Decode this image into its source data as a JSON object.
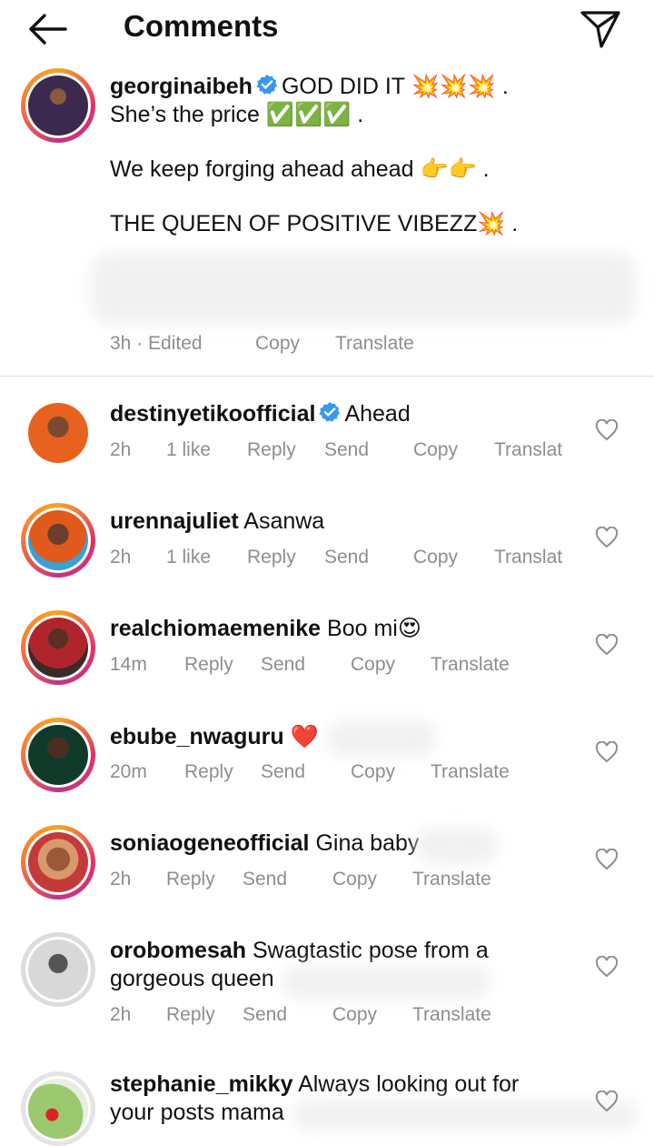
{
  "header": {
    "title": "Comments"
  },
  "caption": {
    "username": "georginaibeh",
    "line1": "GOD DID IT 💥💥💥 .",
    "line2": "She’s the price ✅✅✅ .",
    "line3": "We keep forging ahead ahead 👉👉 .",
    "line4": "THE QUEEN OF POSITIVE VIBEZZ💥 .",
    "time": "3h · Edited",
    "copy": "Copy",
    "translate": "Translate"
  },
  "comments": [
    {
      "username": "destinyetikoofficial",
      "text": "Ahead",
      "time": "2h",
      "likes": "1 like",
      "reply": "Reply",
      "send": "Send",
      "copy": "Copy",
      "translate": "Translat"
    },
    {
      "username": "urennajuliet",
      "text": "Asanwa",
      "time": "2h",
      "likes": "1 like",
      "reply": "Reply",
      "send": "Send",
      "copy": "Copy",
      "translate": "Translat"
    },
    {
      "username": "realchiomaemenike",
      "text": "Boo mi😍",
      "time": "14m",
      "reply": "Reply",
      "send": "Send",
      "copy": "Copy",
      "translate": "Translate"
    },
    {
      "username": "ebube_nwaguru",
      "text": "❤️",
      "time": "20m",
      "reply": "Reply",
      "send": "Send",
      "copy": "Copy",
      "translate": "Translate"
    },
    {
      "username": "soniaogeneofficial",
      "text": "Gina baby",
      "time": "2h",
      "reply": "Reply",
      "send": "Send",
      "copy": "Copy",
      "translate": "Translate"
    },
    {
      "username": "orobomesah",
      "text": "Swagtastic pose from a gorgeous queen",
      "time": "2h",
      "reply": "Reply",
      "send": "Send",
      "copy": "Copy",
      "translate": "Translate"
    },
    {
      "username": "stephanie_mikky",
      "text": "Always looking out for your posts mama"
    }
  ],
  "colors": {
    "verified": "#3897f0",
    "meta": "#8e8e8e",
    "heart_red": "#e0245e"
  },
  "icons": [
    "back-arrow-icon",
    "send-paper-plane-icon",
    "verified-badge-icon",
    "heart-outline-icon"
  ]
}
